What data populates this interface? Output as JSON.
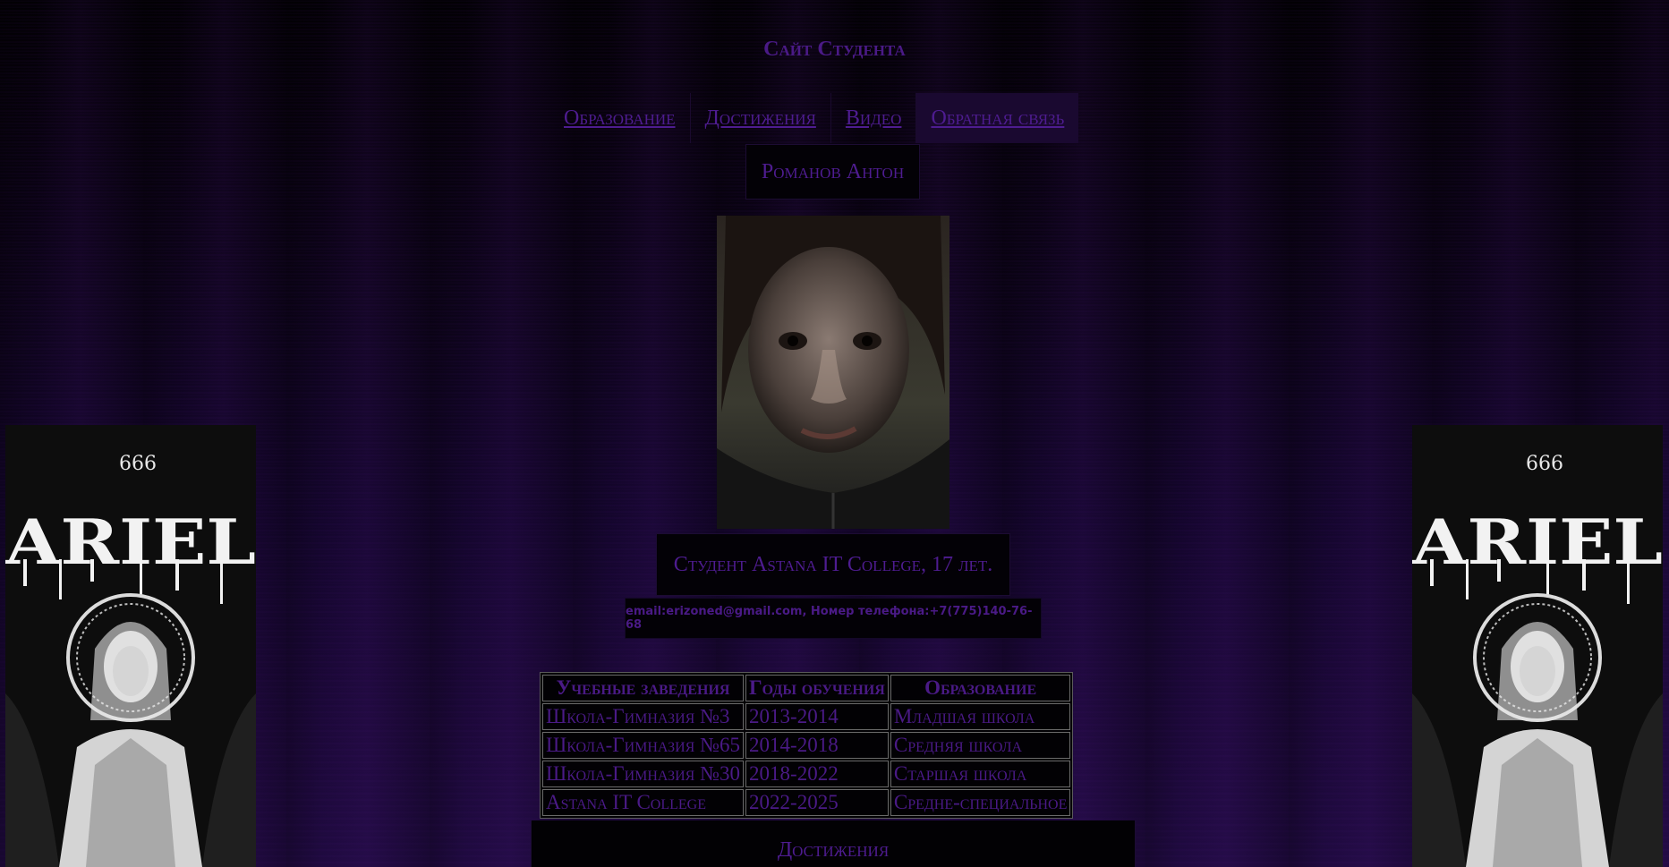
{
  "site": {
    "title": "Сайт Студента"
  },
  "nav": {
    "items": [
      {
        "label": "Образование"
      },
      {
        "label": "Достижения"
      },
      {
        "label": "Видео"
      },
      {
        "label": "Обратная связь",
        "active": true
      }
    ]
  },
  "profile": {
    "name": "Романов Антон",
    "description": "Студент Astana IT College, 17 лет.",
    "contact": "email:erizoned@gmail.com, Номер телефона:+7(775)140-76-68"
  },
  "education_table": {
    "headers": [
      "Учебные заведения",
      "Годы обучения",
      "Образование"
    ],
    "rows": [
      [
        "Школа-Гимназия №3",
        "2013-2014",
        "Младшая школа"
      ],
      [
        "Школа-Гимназия №65",
        "2014-2018",
        "Средняя школа"
      ],
      [
        "Школа-Гимназия №30",
        "2018-2022",
        "Старшая школа"
      ],
      [
        "Astana IT College",
        "2022-2025",
        "Средне-специальное"
      ]
    ]
  },
  "achievements": {
    "heading": "Достижения"
  },
  "posters": {
    "text": "ariel",
    "numbers": "666"
  },
  "colors": {
    "text_purple": "#4e1c90",
    "background": "#000000",
    "active_tab": "#1a0930"
  }
}
